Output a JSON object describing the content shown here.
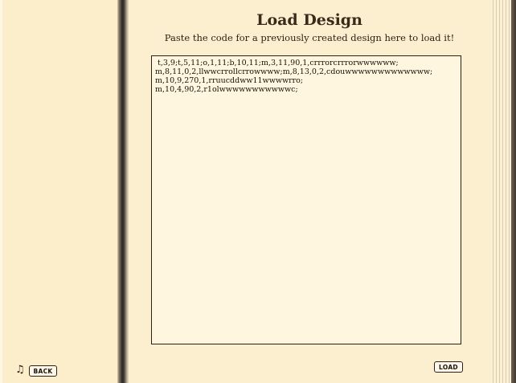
{
  "page": {
    "title": "Load Design",
    "subtitle": "Paste the code for a previously created design here to load it!"
  },
  "code_input": {
    "value": " t,3,9;t,5,11;o,1,11;b,10,11;m,3,11,90,1,crrrorcrrrorwwwwww;\nm,8,11,0,2,llwwcrrollcrrowwww;m,8,13,0,2,cdouwwwwwwwwwwwww;\nm,10,9,270,1,rruucddww11wwwwrro;\nm,10,4,90,2,r1olwwwwwwwwwwwc;"
  },
  "buttons": {
    "back_label": "BACK",
    "load_label": "LOAD"
  },
  "icons": {
    "music": "♫"
  }
}
